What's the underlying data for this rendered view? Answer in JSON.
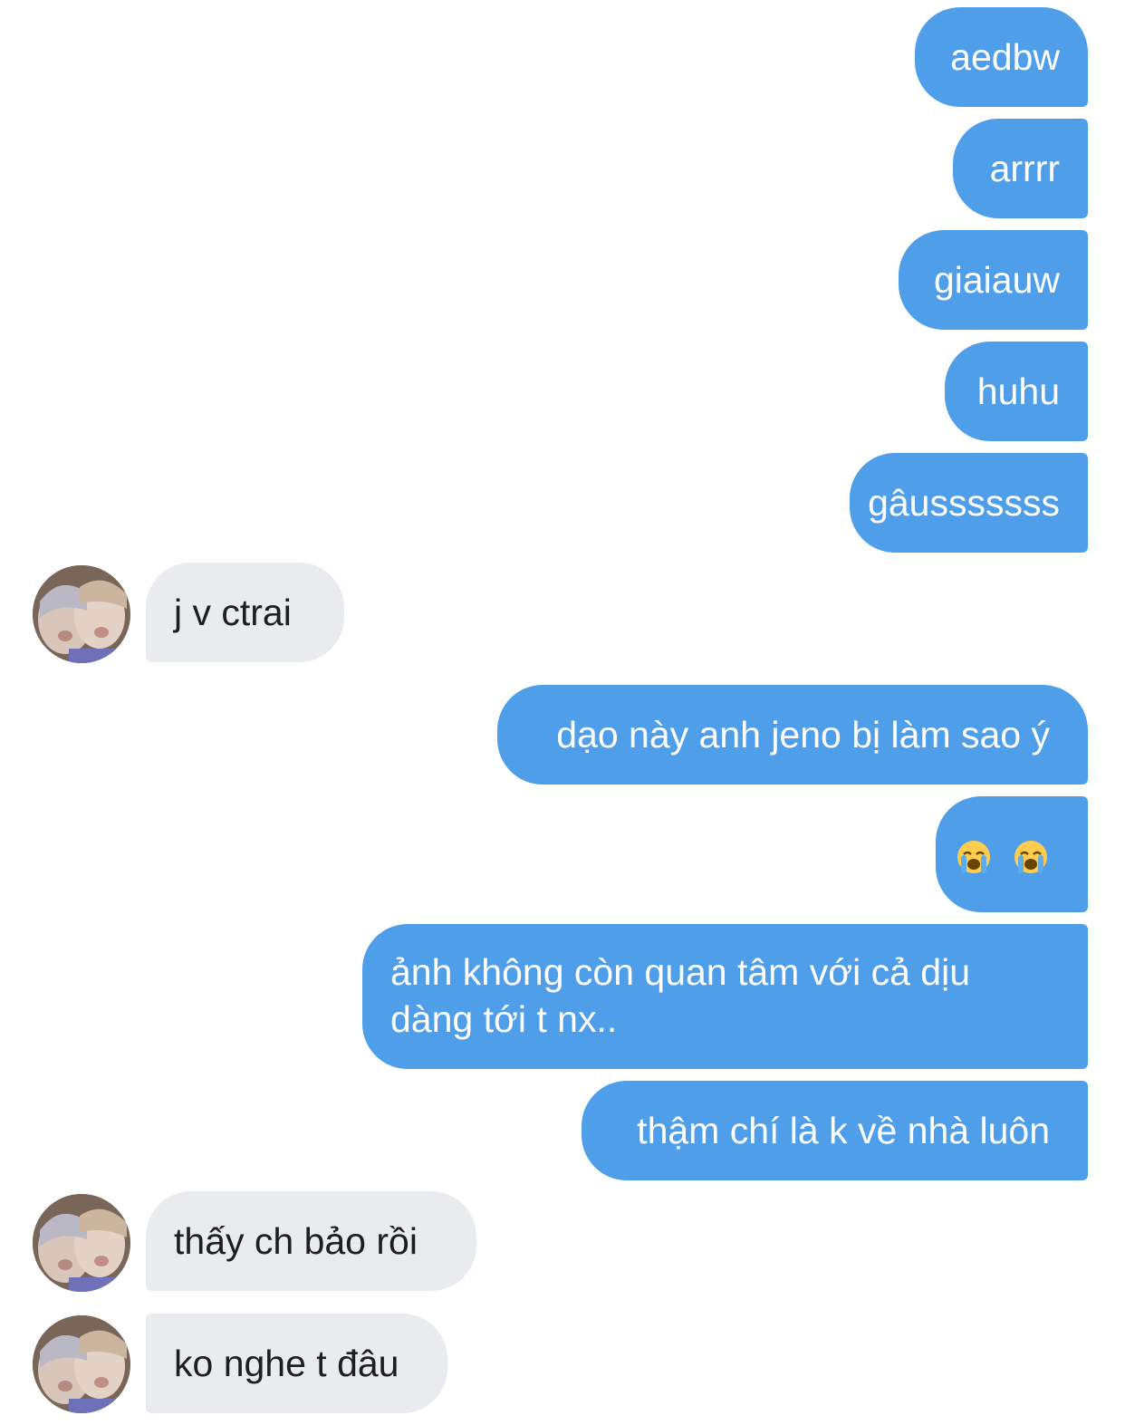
{
  "messages": [
    {
      "id": "m1",
      "side": "out",
      "text": "aedbw"
    },
    {
      "id": "m2",
      "side": "out",
      "text": "arrrr"
    },
    {
      "id": "m3",
      "side": "out",
      "text": "giaiauw"
    },
    {
      "id": "m4",
      "side": "out",
      "text": "huhu"
    },
    {
      "id": "m5",
      "side": "out",
      "text": "gâusssssss"
    },
    {
      "id": "m6",
      "side": "in",
      "text": "j v ctrai"
    },
    {
      "id": "m7",
      "side": "out",
      "text": "dạo này anh jeno bị làm sao ý"
    },
    {
      "id": "m8",
      "side": "out",
      "emoji": [
        "loudly-crying-face",
        "loudly-crying-face"
      ]
    },
    {
      "id": "m9",
      "side": "out",
      "line1": "ảnh không còn quan tâm với cả dịu",
      "line2": "dàng tới t nx.."
    },
    {
      "id": "m10",
      "side": "out",
      "text": "thậm chí là k về nhà luôn"
    },
    {
      "id": "m11",
      "side": "in",
      "text": "thấy ch bảo rồi"
    },
    {
      "id": "m12",
      "side": "in",
      "text": "ko nghe t đâu"
    }
  ],
  "colors": {
    "outgoing_bubble": "#4f9ee9",
    "incoming_bubble": "#e9ebee",
    "outgoing_text": "#ffffff",
    "incoming_text": "#1c1e21"
  },
  "icons": {
    "avatar": "contact-avatar",
    "emoji": "loudly-crying-face"
  }
}
